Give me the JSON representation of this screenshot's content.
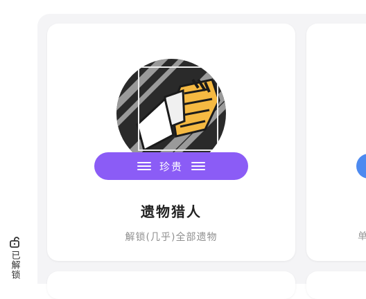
{
  "side": {
    "unlocked_label": "已解锁",
    "icon": "unlock-icon"
  },
  "main_card": {
    "rarity": "珍贵",
    "title": "遗物猎人",
    "description": "解锁(几乎)全部遗物",
    "badge_icon": "relic-claw-badge"
  },
  "right_card": {
    "description_partial": "单"
  },
  "colors": {
    "rarity_bg": "#8b5cf6",
    "right_badge": "#4d8af0",
    "badge_yellow": "#f5b942",
    "badge_gray": "#9a9a9a"
  }
}
